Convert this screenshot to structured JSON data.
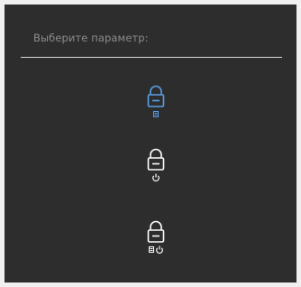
{
  "dialog": {
    "title": "Выберите параметр:"
  },
  "options": [
    {
      "id": "menu-lock",
      "icons": [
        "padlock-icon",
        "menu-icon"
      ],
      "selected": true
    },
    {
      "id": "power-lock",
      "icons": [
        "padlock-icon",
        "power-icon"
      ],
      "selected": false
    },
    {
      "id": "menu-power-lock",
      "icons": [
        "padlock-icon",
        "menu-icon",
        "power-icon"
      ],
      "selected": false
    }
  ],
  "colors": {
    "background": "#2d2d2d",
    "title_text": "#8c8c8c",
    "divider": "#d8d8d8",
    "selected": "#5aa0e6",
    "unselected": "#ffffff"
  }
}
